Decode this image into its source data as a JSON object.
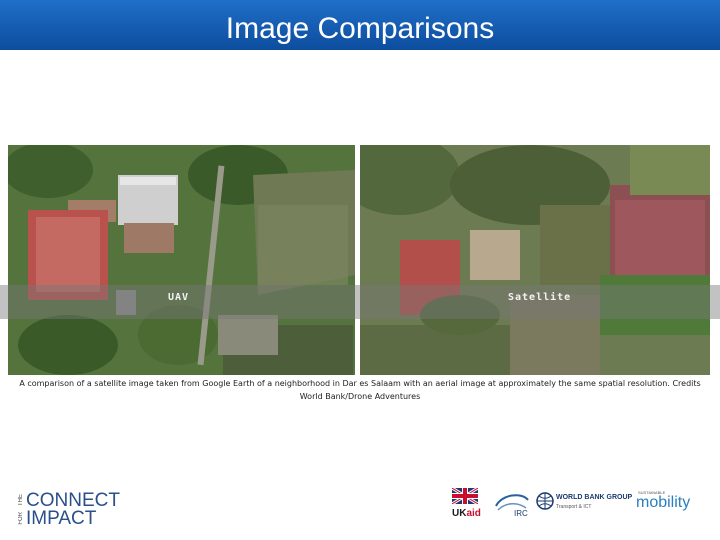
{
  "slide": {
    "title": "Image Comparisons"
  },
  "figure": {
    "left_label": "UAV",
    "right_label": "Satellite",
    "caption": "A comparison of a satellite image taken from Google Earth of a neighborhood in Dar es Salaam with an aerial image at approximately the same spatial resolution. Credits World Bank/Drone Adventures"
  },
  "logos": {
    "connect_prefix": "THE",
    "connect_word": "CONNECT",
    "for_word": "FOR",
    "impact_word": "IMPACT",
    "ukaid_prefix": "UK",
    "ukaid_suffix": "aid",
    "irc_label": "IRC",
    "wbg_name": "WORLD BANK GROUP",
    "wbg_sub": "Transport & ICT",
    "mobility_small": "SUSTAINABLE",
    "mobility_name": "mobility"
  },
  "colors": {
    "title_bar": "#1565c0",
    "brand_blue": "#2b4f8a"
  }
}
